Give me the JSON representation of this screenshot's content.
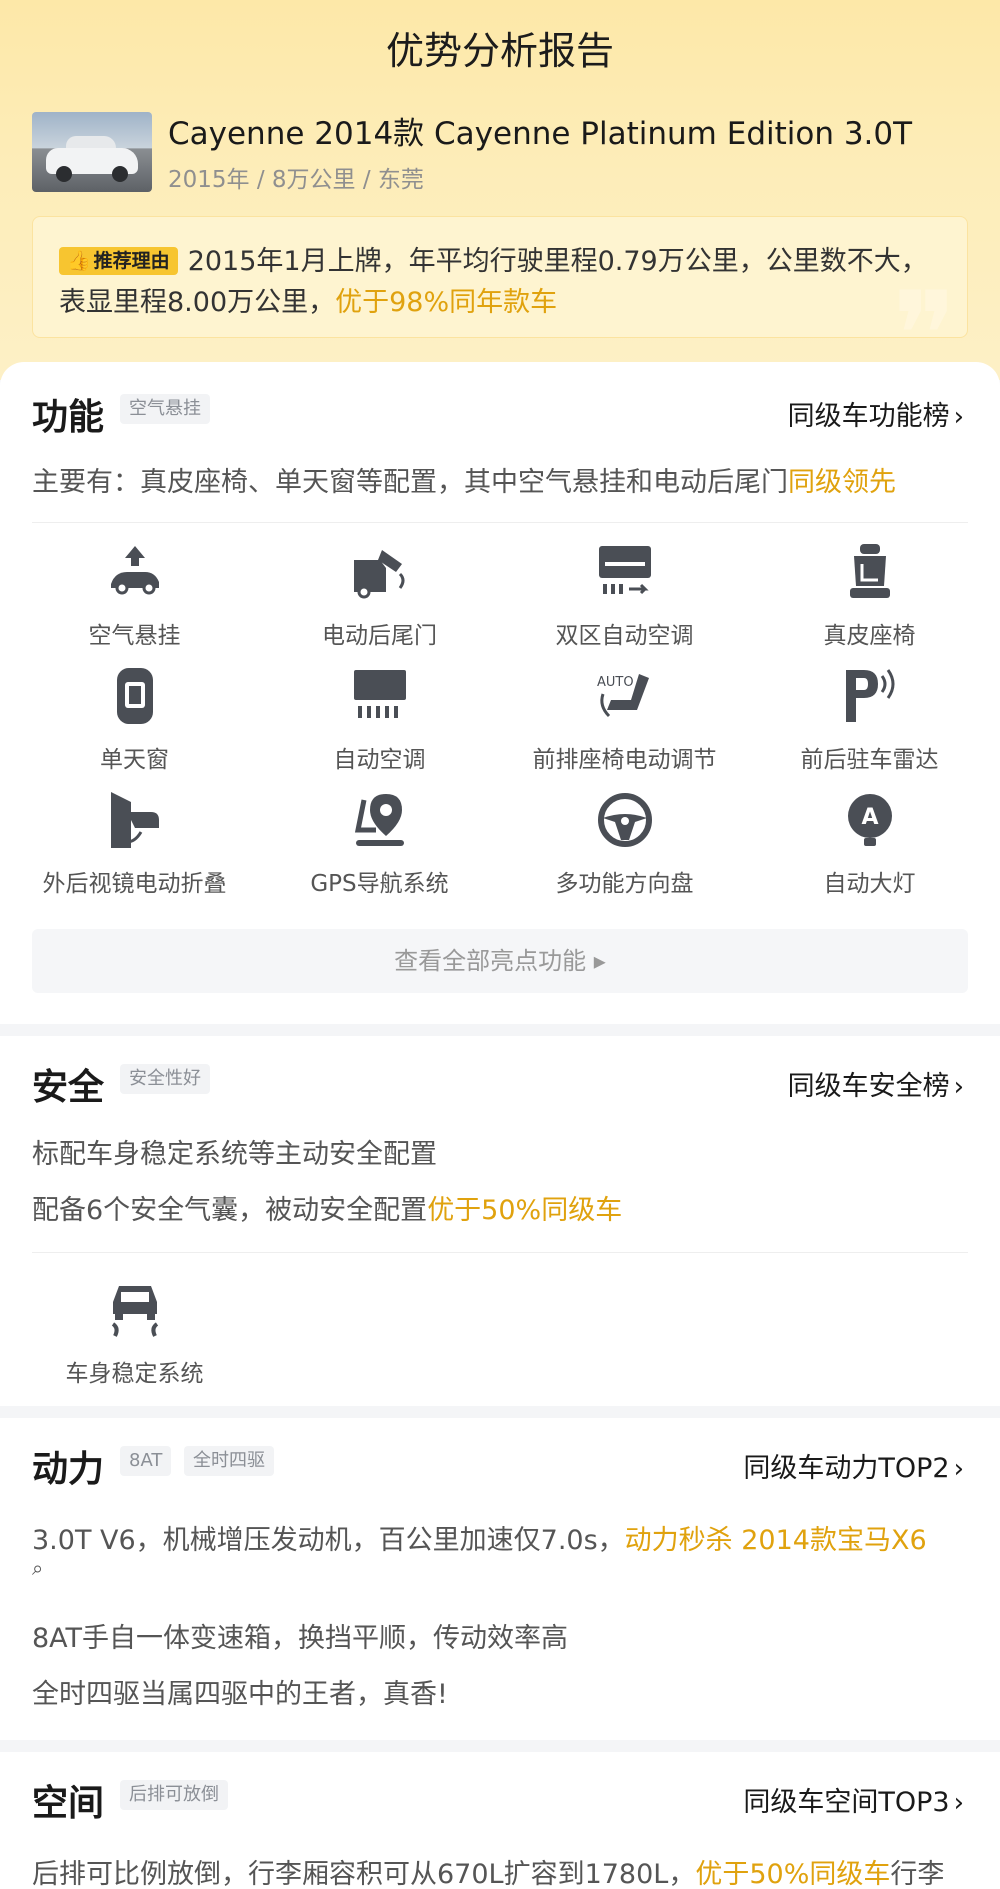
{
  "header": {
    "title": "优势分析报告",
    "car_name": "Cayenne 2014款 Cayenne Platinum Edition 3.0T",
    "car_meta": "2015年 / 8万公里 / 东莞",
    "reason_tag": "推荐理由",
    "reason_text": "2015年1月上牌，年平均行驶里程0.79万公里，公里数不大，表显里程8.00万公里，",
    "reason_highlight": "优于98%同年款车"
  },
  "function": {
    "title": "功能",
    "tag": "空气悬挂",
    "rank": "同级车功能榜",
    "desc": "主要有：真皮座椅、单天窗等配置，其中空气悬挂和电动后尾门",
    "desc_highlight": "同级领先",
    "features": [
      {
        "label": "空气悬挂",
        "icon": "air-suspension-icon"
      },
      {
        "label": "电动后尾门",
        "icon": "power-tailgate-icon"
      },
      {
        "label": "双区自动空调",
        "icon": "dual-zone-ac-icon"
      },
      {
        "label": "真皮座椅",
        "icon": "leather-seat-icon"
      },
      {
        "label": "单天窗",
        "icon": "sunroof-icon"
      },
      {
        "label": "自动空调",
        "icon": "auto-ac-icon"
      },
      {
        "label": "前排座椅电动调节",
        "icon": "power-seat-icon"
      },
      {
        "label": "前后驻车雷达",
        "icon": "parking-radar-icon"
      },
      {
        "label": "外后视镜电动折叠",
        "icon": "mirror-fold-icon"
      },
      {
        "label": "GPS导航系统",
        "icon": "gps-nav-icon"
      },
      {
        "label": "多功能方向盘",
        "icon": "steering-wheel-icon"
      },
      {
        "label": "自动大灯",
        "icon": "auto-headlight-icon"
      }
    ],
    "view_all": "查看全部亮点功能"
  },
  "safety": {
    "title": "安全",
    "tag": "安全性好",
    "rank": "同级车安全榜",
    "desc1": "标配车身稳定系统等主动安全配置",
    "desc2": "配备6个安全气囊，被动安全配置",
    "desc2_highlight": "优于50%同级车",
    "feature_label": "车身稳定系统",
    "feature_icon": "stability-control-icon"
  },
  "power": {
    "title": "动力",
    "tag1": "8AT",
    "tag2": "全时四驱",
    "rank": "同级车动力TOP2",
    "desc1": "3.0T V6，机械增压发动机，百公里加速仅7.0s，",
    "desc1_highlight": "动力秒杀 2014款宝马X6",
    "desc2": "8AT手自一体变速箱，换挡平顺，传动效率高",
    "desc3": "全时四驱当属四驱中的王者，真香!"
  },
  "space": {
    "title": "空间",
    "tag": "后排可放倒",
    "rank": "同级车空间TOP3",
    "desc": "后排可比例放倒，行李厢容积可从670L扩容到1780L，",
    "desc_highlight": "优于50%同级车",
    "desc_tail": "行李"
  },
  "colors": {
    "accent": "#e0a20e",
    "tag_yellow": "#f7c530",
    "icon": "#4a4e55"
  }
}
